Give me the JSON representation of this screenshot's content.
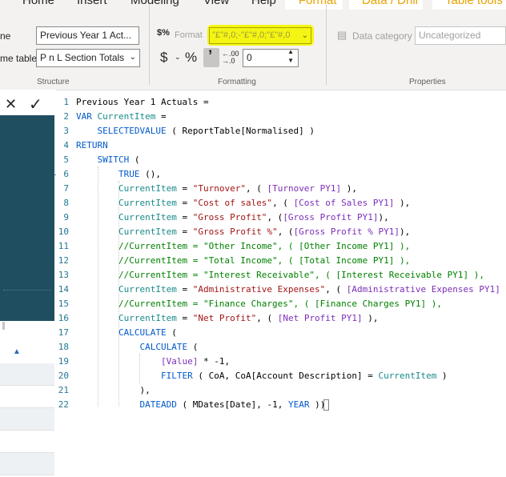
{
  "ribbon": {
    "tabs": [
      {
        "label": "Home"
      },
      {
        "label": "Insert"
      },
      {
        "label": "Modeling"
      },
      {
        "label": "View"
      },
      {
        "label": "Help"
      },
      {
        "label": "Format"
      },
      {
        "label": "Data / Drill"
      },
      {
        "label": "Table tools"
      }
    ],
    "active_tab": "Format",
    "structure": {
      "name_label": "ne",
      "name_value": "Previous Year 1 Act...",
      "home_table_label": "me table",
      "home_table_value": "P n L Section Totals",
      "group_label": "Structure"
    },
    "formatting": {
      "format_label": "Format",
      "format_value": "\"£\"#,0;-\"£\"#,0;\"£\"#,0",
      "currency_symbol": "$",
      "percent_symbol": "%",
      "comma_symbol": "’",
      "decimals_value": "0",
      "group_label": "Formatting"
    },
    "properties": {
      "data_category_label": "Data category",
      "data_category_value": "Uncategorized",
      "group_label": "Properties"
    }
  },
  "editor": {
    "cancel_icon": "close-icon",
    "commit_icon": "check-icon",
    "lines": [
      {
        "n": "1",
        "text": "Previous Year 1 Actuals ="
      },
      {
        "n": "2",
        "text": "VAR CurrentItem ="
      },
      {
        "n": "3",
        "text": "    SELECTEDVALUE ( ReportTable[Normalised] )"
      },
      {
        "n": "4",
        "text": "RETURN"
      },
      {
        "n": "5",
        "text": "    SWITCH ("
      },
      {
        "n": "6",
        "text": "        TRUE (),"
      },
      {
        "n": "7",
        "text": "        CurrentItem = \"Turnover\", ( [Turnover PY1] ),"
      },
      {
        "n": "8",
        "text": "        CurrentItem = \"Cost of sales\", ( [Cost of Sales PY1] ),"
      },
      {
        "n": "9",
        "text": "        CurrentItem = \"Gross Profit\", ([Gross Profit PY1]),"
      },
      {
        "n": "10",
        "text": "        CurrentItem = \"Gross Profit %\", ([Gross Profit % PY1]),"
      },
      {
        "n": "11",
        "text": "        //CurrentItem = \"Other Income\", ( [Other Income PY1] ),"
      },
      {
        "n": "12",
        "text": "        //CurrentItem = \"Total Income\", ( [Total Income PY1] ),"
      },
      {
        "n": "13",
        "text": "        //CurrentItem = \"Interest Receivable\", ( [Interest Receivable PY1] ),"
      },
      {
        "n": "14",
        "text": "        CurrentItem = \"Administrative Expenses\", ( [Administrative Expenses PY1] ),"
      },
      {
        "n": "15",
        "text": "        //CurrentItem = \"Finance Charges\", ( [Finance Charges PY1] ),"
      },
      {
        "n": "16",
        "text": "        CurrentItem = \"Net Profit\", ( [Net Profit PY1] ),"
      },
      {
        "n": "17",
        "text": "        CALCULATE ("
      },
      {
        "n": "18",
        "text": "            CALCULATE ("
      },
      {
        "n": "19",
        "text": "                [Value] * -1,"
      },
      {
        "n": "20",
        "text": "                FILTER ( CoA, CoA[Account Description] = CurrentItem )"
      },
      {
        "n": "21",
        "text": "            ),"
      },
      {
        "n": "22",
        "text": "            DATEADD ( MDates[Date], -1, YEAR ))"
      }
    ]
  },
  "colors": {
    "highlight": "#f5f514",
    "active_tab": "#e8a200",
    "side_panel": "#1f4e60",
    "keyword": "#035aca",
    "function": "#3165bb",
    "string": "#a31515",
    "measure": "#7c2eb8",
    "comment": "#008000",
    "variable": "#198a8a"
  }
}
